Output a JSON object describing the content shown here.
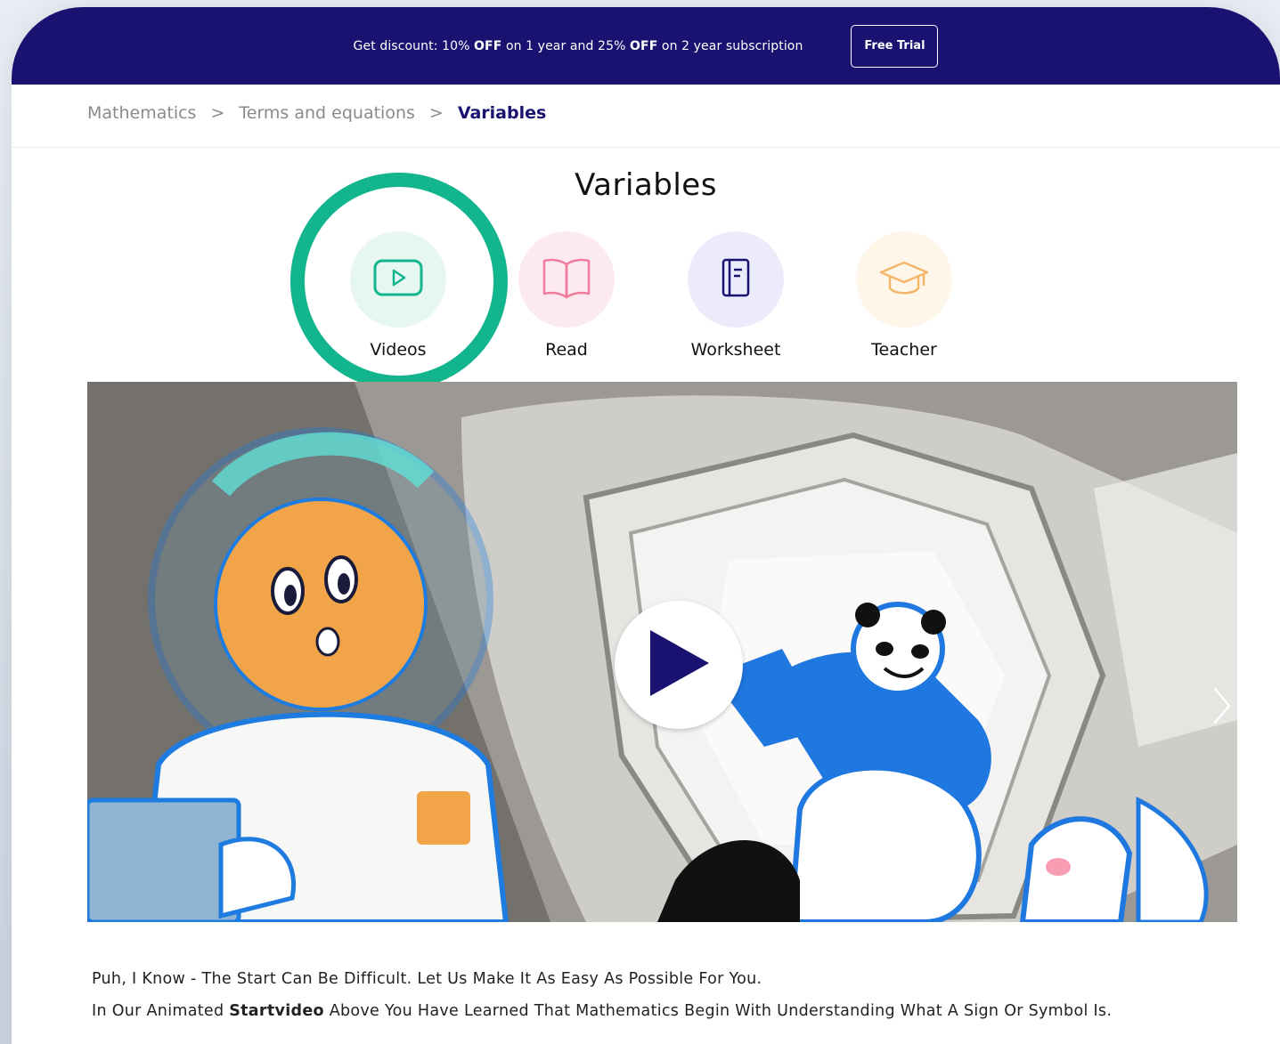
{
  "promo": {
    "text_parts": [
      "Get discount: 10% ",
      "OFF",
      " on 1 year and 25% ",
      "OFF",
      " on 2 year subscription"
    ],
    "button": "Free Trial"
  },
  "breadcrumb": {
    "items": [
      "Mathematics",
      "Terms and equations",
      "Variables"
    ],
    "separator": ">"
  },
  "page_title": "Variables",
  "tabs": [
    {
      "label": "Videos",
      "icon": "video-play-icon",
      "bg": "#e6f6f1",
      "color": "#13b58e"
    },
    {
      "label": "Read",
      "icon": "open-book-icon",
      "bg": "#fdeaf0",
      "color": "#f07c9c"
    },
    {
      "label": "Worksheet",
      "icon": "notebook-icon",
      "bg": "#ecebfb",
      "color": "#1a1270"
    },
    {
      "label": "Teacher",
      "icon": "graduation-cap-icon",
      "bg": "#fff6ea",
      "color": "#f4b56a"
    }
  ],
  "description": {
    "line1": "Puh, I Know - The Start Can Be Difficult. Let Us Make It As Easy As Possible For You.",
    "line2_before": "In Our Animated ",
    "line2_bold": "Startvideo",
    "line2_after": " Above You Have Learned That Mathematics Begin With Understanding What A Sign Or Symbol Is."
  },
  "colors": {
    "brand": "#1a1270",
    "highlight": "#13b58e"
  }
}
